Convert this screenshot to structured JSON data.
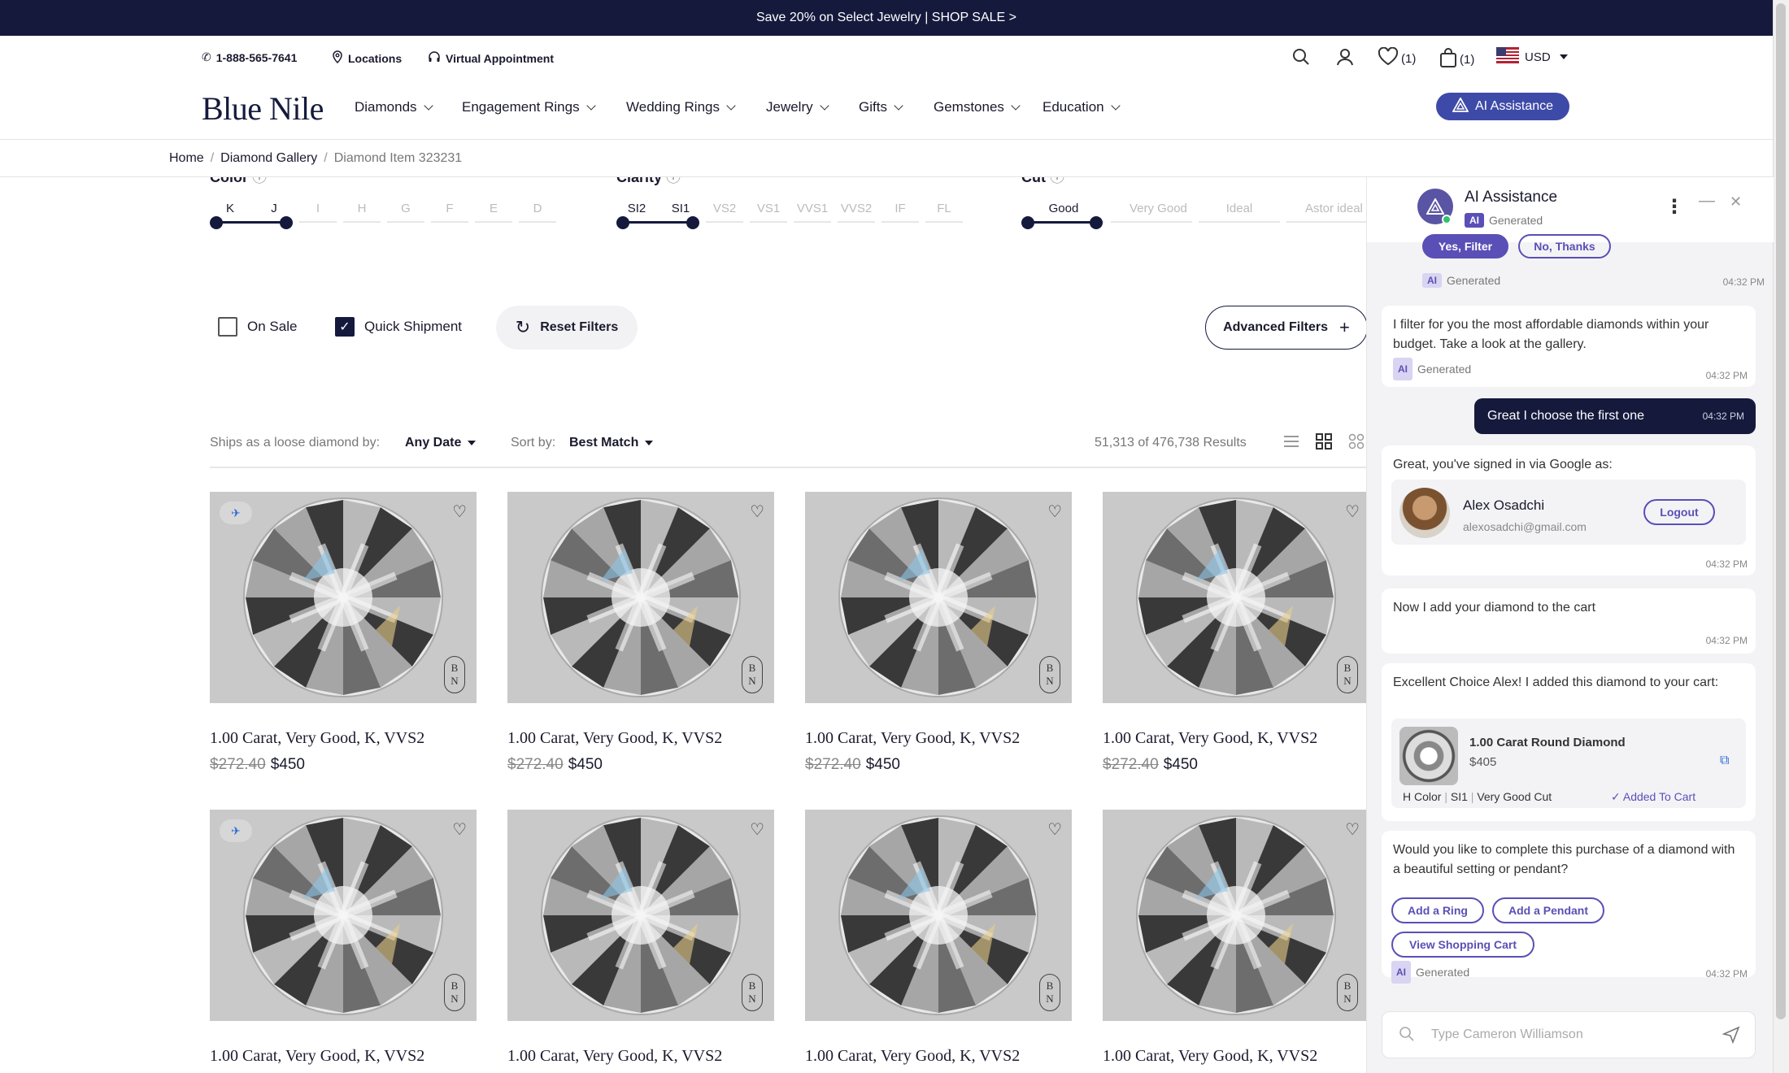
{
  "promo": {
    "text": "Save 20% on Select Jewelry | SHOP SALE >"
  },
  "utility": {
    "phone": "1-888-565-7641",
    "locations": "Locations",
    "appointment": "Virtual Appointment",
    "wishlist_count": "(1)",
    "cart_count": "(1)",
    "currency": "USD"
  },
  "nav": {
    "logo": "Blue Nile",
    "items": [
      "Diamonds",
      "Engagement Rings",
      "Wedding Rings",
      "Jewelry",
      "Gifts",
      "Gemstones",
      "Education"
    ],
    "ai_button": "AI Assistance"
  },
  "breadcrumb": {
    "items": [
      "Home",
      "Diamond Gallery"
    ],
    "current": "Diamond Item 323231"
  },
  "filters": {
    "color": {
      "title": "Color",
      "grades": [
        "K",
        "J",
        "I",
        "H",
        "G",
        "F",
        "E",
        "D"
      ],
      "selected": [
        "K",
        "J"
      ]
    },
    "clarity": {
      "title": "Clarity",
      "grades": [
        "SI2",
        "SI1",
        "VS2",
        "VS1",
        "VVS1",
        "VVS2",
        "IF",
        "FL"
      ],
      "selected": [
        "SI2",
        "SI1"
      ]
    },
    "cut": {
      "title": "Cut",
      "grades": [
        "Good",
        "Very Good",
        "Ideal",
        "Astor ideal"
      ],
      "selected": [
        "Good"
      ]
    },
    "on_sale": {
      "label": "On Sale",
      "checked": false
    },
    "quick_shipment": {
      "label": "Quick Shipment",
      "checked": true
    },
    "reset": "Reset Filters",
    "advanced": "Advanced Filters"
  },
  "sort": {
    "ships_label": "Ships as a loose diamond by:",
    "ships_value": "Any Date",
    "sort_label": "Sort by:",
    "sort_value": "Best Match",
    "results": "51,313 of 476,738 Results"
  },
  "products": [
    {
      "name": "1.00 Carat, Very Good, K, VVS2",
      "old_price": "$272.40",
      "price": "$450",
      "badge": true
    },
    {
      "name": "1.00 Carat, Very Good, K, VVS2",
      "old_price": "$272.40",
      "price": "$450",
      "badge": false
    },
    {
      "name": "1.00 Carat, Very Good, K, VVS2",
      "old_price": "$272.40",
      "price": "$450",
      "badge": false
    },
    {
      "name": "1.00 Carat, Very Good, K, VVS2",
      "old_price": "$272.40",
      "price": "$450",
      "badge": false
    },
    {
      "name": "1.00 Carat, Very Good, K, VVS2",
      "old_price": "",
      "price": "",
      "badge": true
    },
    {
      "name": "1.00 Carat, Very Good, K, VVS2",
      "old_price": "",
      "price": "",
      "badge": false
    },
    {
      "name": "1.00 Carat, Very Good, K, VVS2",
      "old_price": "",
      "price": "",
      "badge": false
    },
    {
      "name": "1.00 Carat, Very Good, K, VVS2",
      "old_price": "",
      "price": "",
      "badge": false
    }
  ],
  "chat": {
    "title": "AI Assistance",
    "ai_tag": "AI",
    "generated": "Generated",
    "time": "04:32 PM",
    "yes_filter": "Yes, Filter",
    "no_thanks": "No, Thanks",
    "msg_filter": "I filter for you the most affordable diamonds within your budget. Take a look at the gallery.",
    "user_msg": "Great I choose the first one",
    "msg_signed": "Great, you've signed in via Google as:",
    "user_name": "Alex Osadchi",
    "user_email": "alexosadchi@gmail.com",
    "logout": "Logout",
    "msg_added": "Now I add your diamond to the cart",
    "msg_excellent": "Excellent Choice Alex! I added this diamond to your cart:",
    "cart_item_name": "1.00 Carat Round Diamond",
    "cart_item_price": "$405",
    "cart_item_color": "H Color",
    "cart_item_clarity": "SI1",
    "cart_item_cut": "Very Good Cut",
    "added_to_cart": "Added To Cart",
    "msg_complete": "Would you like to complete this purchase of a diamond with a beautiful setting or pendant?",
    "add_ring": "Add a Ring",
    "add_pendant": "Add a Pendant",
    "view_cart": "View Shopping Cart",
    "input_placeholder": "Type Cameron Williamson"
  },
  "colors": {
    "navy": "#151a3d",
    "accent": "#5a4fb6",
    "ai_button": "#3e4aa8"
  }
}
